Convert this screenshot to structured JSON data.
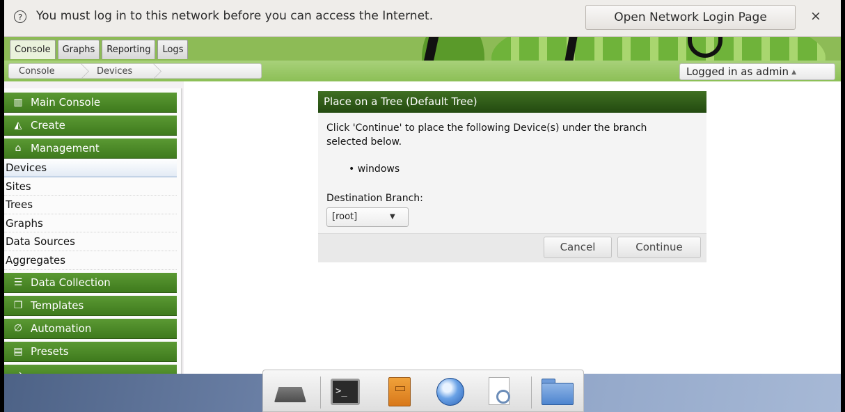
{
  "notification": {
    "message": "You must log in to this network before you can access the Internet.",
    "login_button": "Open Network Login Page",
    "close_glyph": "×",
    "icon": "help-circle-icon"
  },
  "tabs": [
    {
      "label": "Console",
      "active": true
    },
    {
      "label": "Graphs",
      "active": false
    },
    {
      "label": "Reporting",
      "active": false
    },
    {
      "label": "Logs",
      "active": false
    }
  ],
  "breadcrumb": {
    "items": [
      "Console",
      "Devices"
    ]
  },
  "user_menu": {
    "label": "Logged in as admin",
    "caret": "▲"
  },
  "sidebar": {
    "main_console": {
      "label": "Main Console",
      "icon": "map-icon"
    },
    "create": {
      "label": "Create",
      "icon": "area-chart-icon"
    },
    "management": {
      "label": "Management",
      "icon": "home-icon",
      "items": [
        "Devices",
        "Sites",
        "Trees",
        "Graphs",
        "Data Sources",
        "Aggregates"
      ],
      "selected": "Devices"
    },
    "data_collection": {
      "label": "Data Collection",
      "icon": "database-icon"
    },
    "templates": {
      "label": "Templates",
      "icon": "clone-icon"
    },
    "automation": {
      "label": "Automation",
      "icon": "empty-set-icon"
    },
    "presets": {
      "label": "Presets",
      "icon": "archive-icon"
    }
  },
  "dialog": {
    "title": "Place on a Tree (Default Tree)",
    "message": "Click 'Continue' to place the following Device(s) under the branch selected below.",
    "devices": [
      "windows"
    ],
    "destination_label": "Destination Branch:",
    "destination_value": "[root]",
    "cancel_label": "Cancel",
    "continue_label": "Continue"
  },
  "dock": {
    "icons": [
      "drive-icon",
      "terminal-icon",
      "file-cabinet-icon",
      "web-browser-icon",
      "document-viewer-icon",
      "folder-icon"
    ],
    "terminal_glyph": ">_"
  },
  "colors": {
    "menu_header": "#4b8a25",
    "dialog_title": "#2f5c18",
    "header_green": "#8dbb56"
  }
}
